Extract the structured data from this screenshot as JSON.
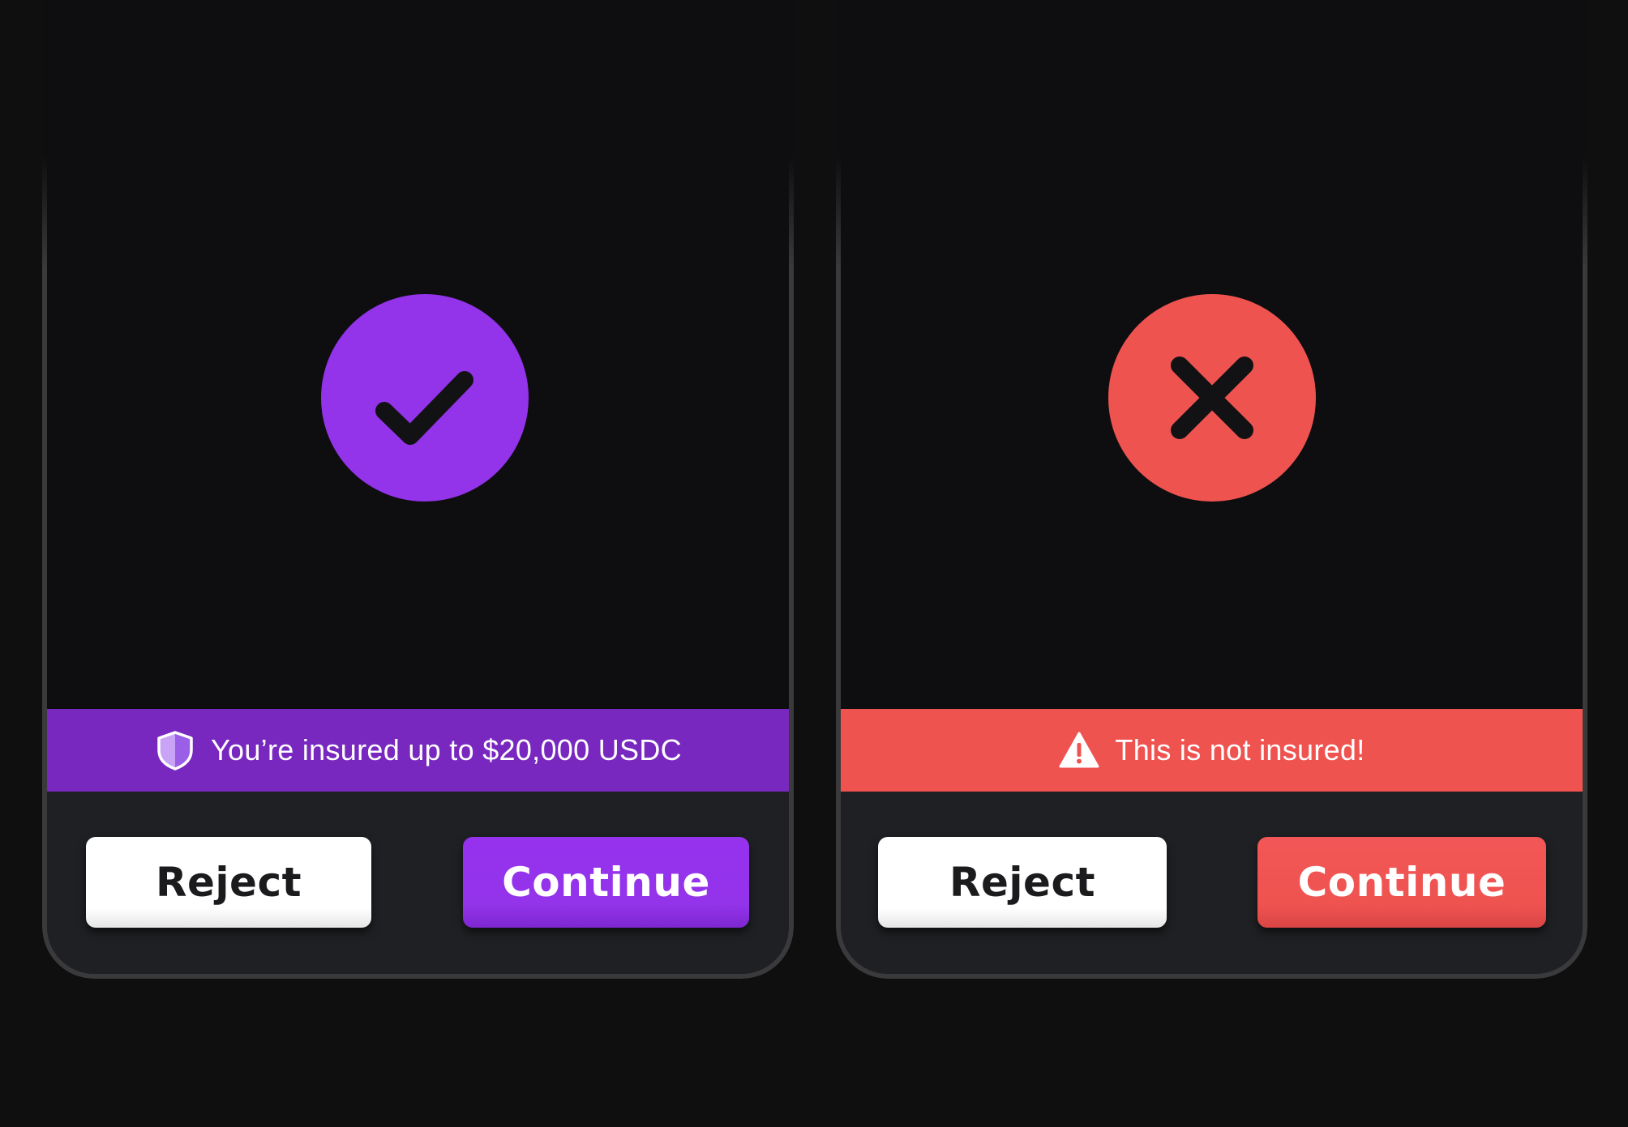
{
  "colors": {
    "background": "#0f0f10",
    "panel_border": "#3a3a3c",
    "footer": "#1e2023",
    "purple_accent": "#9333ea",
    "purple_banner": "#7828bf",
    "red_accent": "#ef5350",
    "red_banner": "#ef5350",
    "white": "#ffffff"
  },
  "insured_panel": {
    "status_icon": "checkmark-icon",
    "banner_icon": "shield-icon",
    "banner_text": "You’re insured up to $20,000 USDC",
    "reject_label": "Reject",
    "continue_label": "Continue"
  },
  "uninsured_panel": {
    "status_icon": "x-mark-icon",
    "banner_icon": "warning-icon",
    "banner_text": "This is not insured!",
    "reject_label": "Reject",
    "continue_label": "Continue"
  }
}
